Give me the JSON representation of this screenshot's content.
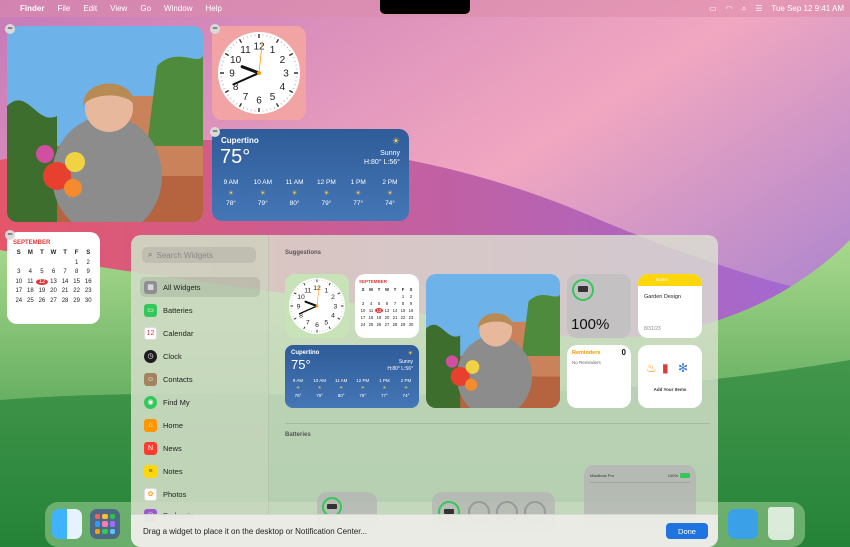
{
  "menubar": {
    "app": "Finder",
    "menus": [
      "File",
      "Edit",
      "View",
      "Go",
      "Window",
      "Help"
    ],
    "clock": "Tue Sep 12  9:41 AM",
    "icons": [
      "battery-icon",
      "wifi-icon",
      "search-icon",
      "control-center-icon"
    ]
  },
  "desktop_widgets": {
    "weather": {
      "city": "Cupertino",
      "temp": "75°",
      "condition": "Sunny",
      "hilo": "H:80° L:56°",
      "hours": [
        {
          "time": "9 AM",
          "temp": "78°"
        },
        {
          "time": "10 AM",
          "temp": "79°"
        },
        {
          "time": "11 AM",
          "temp": "80°"
        },
        {
          "time": "12 PM",
          "temp": "79°"
        },
        {
          "time": "1 PM",
          "temp": "77°"
        },
        {
          "time": "2 PM",
          "temp": "74°"
        }
      ]
    },
    "calendar": {
      "month": "SEPTEMBER",
      "days": [
        "S",
        "M",
        "T",
        "W",
        "T",
        "F",
        "S"
      ],
      "weeks": [
        [
          "",
          "",
          "",
          "",
          "",
          "1",
          "2"
        ],
        [
          "3",
          "4",
          "5",
          "6",
          "7",
          "8",
          "9"
        ],
        [
          "10",
          "11",
          "12",
          "13",
          "14",
          "15",
          "16"
        ],
        [
          "17",
          "18",
          "19",
          "20",
          "21",
          "22",
          "23"
        ],
        [
          "24",
          "25",
          "26",
          "27",
          "28",
          "29",
          "30"
        ]
      ],
      "today": "12"
    },
    "clock": {
      "hour": 9,
      "minute": 41
    }
  },
  "gallery": {
    "search_placeholder": "Search Widgets",
    "sidebar": [
      {
        "label": "All Widgets",
        "color": "#8e8e93",
        "icon": "all-widgets-icon"
      },
      {
        "label": "Batteries",
        "color": "#34c759",
        "icon": "battery-icon"
      },
      {
        "label": "Calendar",
        "color": "#ffffff",
        "icon": "calendar-icon"
      },
      {
        "label": "Clock",
        "color": "#1c1c1e",
        "icon": "clock-icon"
      },
      {
        "label": "Contacts",
        "color": "#a2845e",
        "icon": "contacts-icon"
      },
      {
        "label": "Find My",
        "color": "#34c759",
        "icon": "find-my-icon"
      },
      {
        "label": "Home",
        "color": "#ff9500",
        "icon": "home-icon"
      },
      {
        "label": "News",
        "color": "#ff3b30",
        "icon": "news-icon"
      },
      {
        "label": "Notes",
        "color": "#ffd60a",
        "icon": "notes-icon"
      },
      {
        "label": "Photos",
        "color": "#ff9f0a",
        "icon": "photos-icon"
      },
      {
        "label": "Podcasts",
        "color": "#9b59d0",
        "icon": "podcasts-icon"
      }
    ],
    "suggestions_title": "Suggestions",
    "batteries_title": "Batteries",
    "battery_percent": "100%",
    "battery_level": 1.0,
    "notes": {
      "app": "Notes",
      "title": "Garden Design",
      "date": "8/31/23"
    },
    "reminders": {
      "title": "Reminders",
      "count": "0",
      "subtitle": "No Reminders"
    },
    "home": {
      "label": "Add Your Items"
    },
    "macbook": {
      "name": "MacBook Pro",
      "percent": "100%"
    },
    "bottom_text": "Drag a widget to place it on the desktop or Notification Center...",
    "done_label": "Done"
  },
  "colors": {
    "accent": "#1f74e0",
    "calendar_red": "#e0393a",
    "battery_green": "#34c759",
    "weather_blue": "#3a68a8"
  }
}
